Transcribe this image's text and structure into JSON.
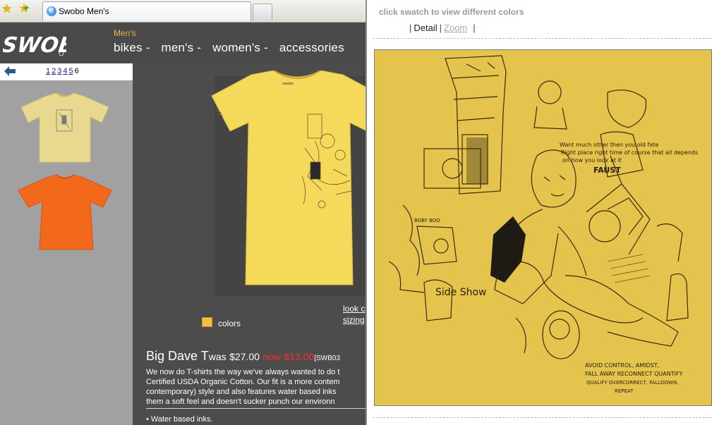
{
  "browser": {
    "tab_title": "Swobo Men's"
  },
  "header": {
    "logo_text": "SWOBO",
    "breadcrumb": "Men's",
    "nav": [
      "bikes -",
      "men's -",
      "women's -",
      "accessories"
    ]
  },
  "pager": {
    "pages": [
      "1",
      "2",
      "3",
      "4",
      "5"
    ],
    "current": "6"
  },
  "thumbnails": [
    {
      "color_name": "yellow",
      "color": "#e8d98e"
    },
    {
      "color_name": "orange",
      "color": "#f2691b"
    }
  ],
  "product": {
    "colors_label": "colors",
    "swatch_color": "#f2c23c",
    "look_link": "look c",
    "sizing_link": "sizing",
    "name": "Big Dave T",
    "was_label": "was",
    "was_price": "$27.00",
    "now_label": "now",
    "now_price": "$13.00",
    "sku": "[SWB03",
    "description": [
      "We now do T-shirts the way we've always wanted to do t",
      "Certified USDA Organic Cotton. Our fit is a more contem",
      "contemporary) style and also features water based inks",
      "them a soft feel and doesn't sucker punch our environn"
    ],
    "bullet": "• Water based inks."
  },
  "detail_panel": {
    "hint": "click swatch to view different colors",
    "detail_label": "Detail",
    "zoom_label": "Zoom",
    "art_text_1": "Want much other then you old fate",
    "art_text_2": "Right place right time of course that all depends",
    "art_text_3": "on how you look at it",
    "art_text_4": "FAUST",
    "art_text_5": "BOBY BOO",
    "art_text_6": "Side Show",
    "art_text_7": "AVOID CONTROL, AMIDST,",
    "art_text_8": "FALL AWAY RECONNECT QUANTIFY",
    "art_text_9": "QUALIFY OVERCORRECT, FALLDOWN,",
    "art_text_10": "REPEAT"
  }
}
